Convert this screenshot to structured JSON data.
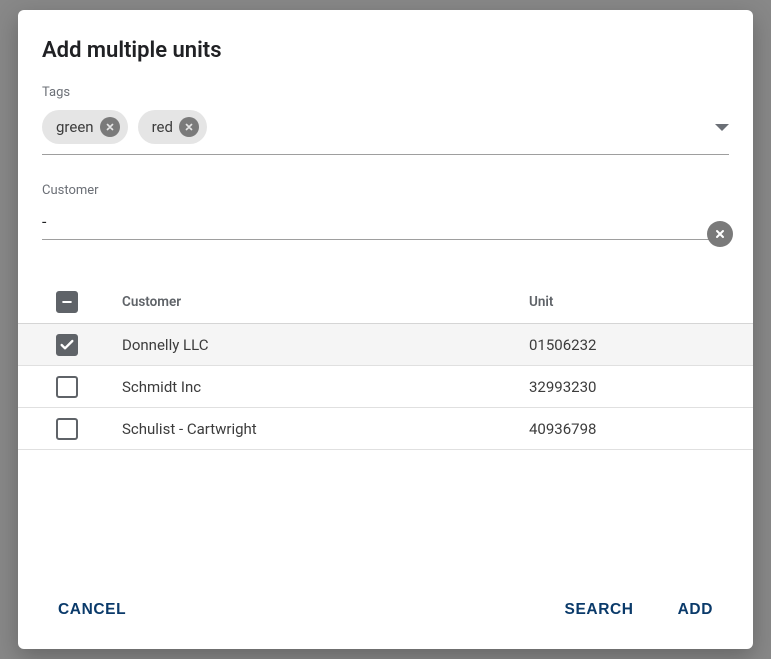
{
  "dialog": {
    "title": "Add multiple units"
  },
  "tags": {
    "label": "Tags",
    "chips": [
      "green",
      "red"
    ]
  },
  "customer": {
    "label": "Customer",
    "value": "-"
  },
  "table": {
    "headers": {
      "customer": "Customer",
      "unit": "Unit"
    },
    "rows": [
      {
        "customer": "Donnelly LLC",
        "unit": "01506232",
        "checked": true
      },
      {
        "customer": "Schmidt Inc",
        "unit": "32993230",
        "checked": false
      },
      {
        "customer": "Schulist - Cartwright",
        "unit": "40936798",
        "checked": false
      }
    ],
    "header_state": "indeterminate"
  },
  "actions": {
    "cancel": "CANCEL",
    "search": "SEARCH",
    "add": "ADD"
  }
}
